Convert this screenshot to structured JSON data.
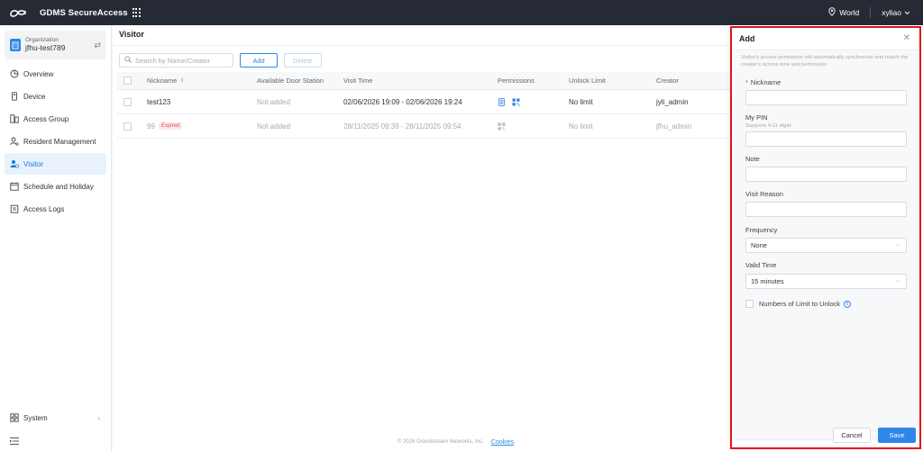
{
  "topbar": {
    "app_title": "GDMS SecureAccess",
    "region": "World",
    "user": "xyliao"
  },
  "sidebar": {
    "org_label": "Organization",
    "org_name": "jfhu-test789",
    "items": [
      {
        "label": "Overview",
        "icon": "overview-icon"
      },
      {
        "label": "Device",
        "icon": "device-icon"
      },
      {
        "label": "Access Group",
        "icon": "access-group-icon"
      },
      {
        "label": "Resident Management",
        "icon": "resident-icon"
      },
      {
        "label": "Visitor",
        "icon": "visitor-icon",
        "active": true
      },
      {
        "label": "Schedule and Holiday",
        "icon": "calendar-icon"
      },
      {
        "label": "Access Logs",
        "icon": "logs-icon"
      }
    ],
    "system_label": "System"
  },
  "main": {
    "title": "Visitor",
    "search_placeholder": "Search by Name/Creator",
    "add_label": "Add",
    "delete_label": "Delete",
    "columns": [
      "Nickname",
      "Available Door Station",
      "Visit Time",
      "Permissions",
      "Unlock Limit",
      "Creator"
    ],
    "rows": [
      {
        "nickname": "test123",
        "expired_label": "",
        "door_station": "Not added",
        "visit_time": "02/06/2026 19:09 - 02/06/2026 19:24",
        "unlock_limit": "No limit",
        "creator": "jyli_admin",
        "dim": false
      },
      {
        "nickname": "99",
        "expired_label": "Expired",
        "door_station": "Not added",
        "visit_time": "28/11/2025 09:39 - 28/11/2025 09:54",
        "unlock_limit": "No limit",
        "creator": "jfhu_admin",
        "dim": true
      }
    ]
  },
  "footer": {
    "copyright": "© 2026 Grandstream Networks, Inc.",
    "cookies": "Cookies"
  },
  "drawer": {
    "title": "Add",
    "tip": "Visitor's access permission will automatically synchronize and match the creator's access time and permission",
    "nickname_label": "Nickname",
    "pin_label": "My PIN",
    "pin_sub": "Supports 4-11 digits",
    "note_label": "Note",
    "reason_label": "Visit Reason",
    "frequency_label": "Frequency",
    "frequency_value": "None",
    "valid_time_label": "Valid Time",
    "valid_time_value": "15 minutes",
    "limit_label": "Numbers of Limit to Unlock",
    "cancel_label": "Cancel",
    "save_label": "Save"
  },
  "colors": {
    "accent": "#2f86e9",
    "topbar": "#252a34",
    "highlight": "#e0141c",
    "expired": "#e55353"
  }
}
